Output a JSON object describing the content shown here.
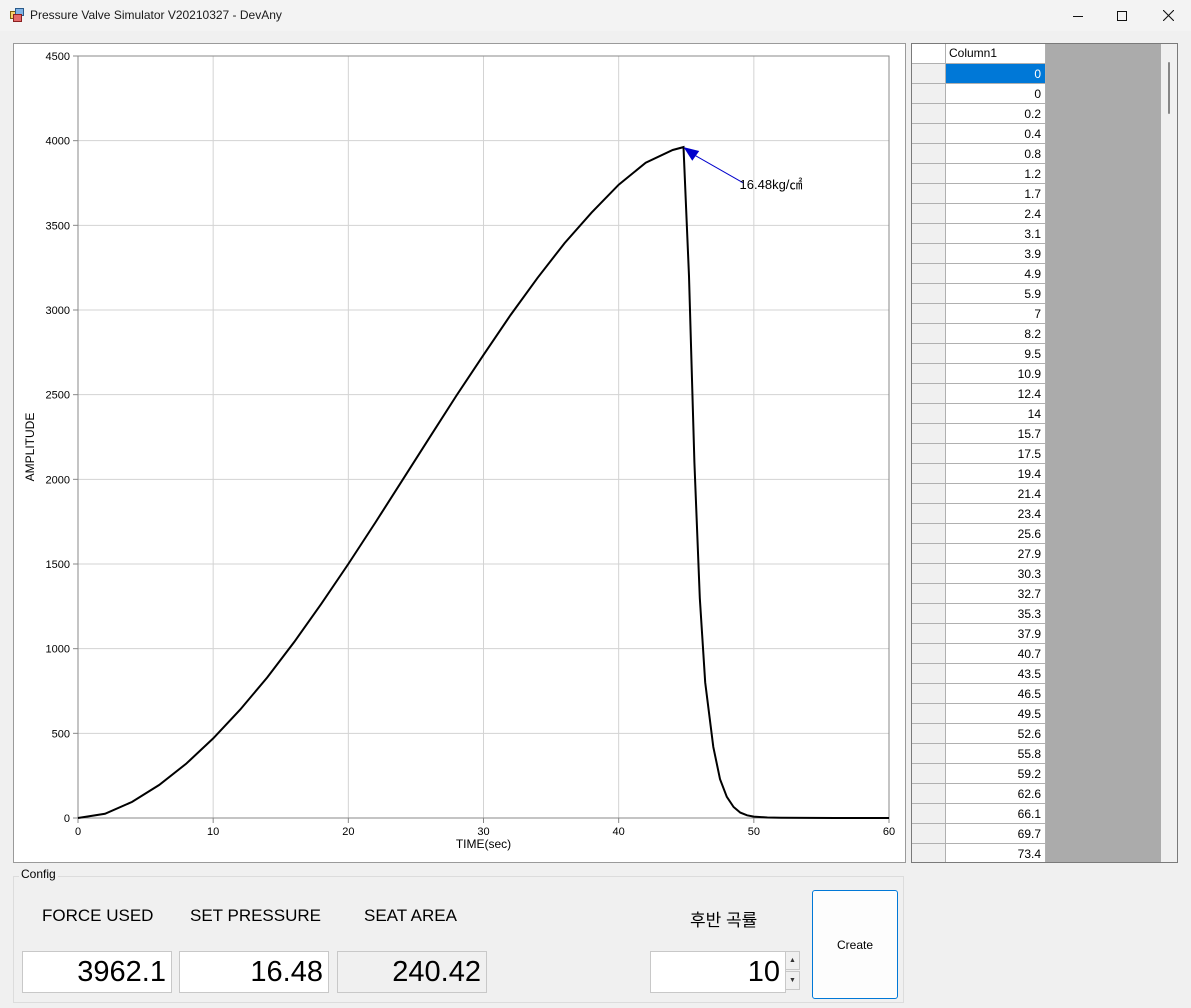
{
  "window": {
    "title": "Pressure Valve Simulator V20210327 - DevAny"
  },
  "chart_data": {
    "type": "line",
    "title": "",
    "xlabel": "TIME(sec)",
    "ylabel": "AMPLITUDE",
    "xlim": [
      0,
      60
    ],
    "ylim": [
      0,
      4500
    ],
    "xticks": [
      "0",
      "10",
      "20",
      "30",
      "40",
      "50",
      "60"
    ],
    "yticks": [
      "0",
      "500",
      "1000",
      "1500",
      "2000",
      "2500",
      "3000",
      "3500",
      "4000",
      "4500"
    ],
    "grid": true,
    "series": [
      {
        "color": "#000000",
        "x": [
          0,
          2,
          4,
          6,
          8,
          10,
          12,
          14,
          16,
          18,
          20,
          22,
          24,
          26,
          28,
          30,
          32,
          34,
          36,
          38,
          40,
          42,
          44,
          44.8,
          45.2,
          45.6,
          46,
          46.4,
          47,
          47.5,
          48,
          48.5,
          49,
          49.5,
          50,
          51,
          52,
          56,
          60
        ],
        "y": [
          0,
          25,
          95,
          195,
          320,
          470,
          640,
          830,
          1040,
          1265,
          1500,
          1745,
          1995,
          2245,
          2495,
          2735,
          2970,
          3190,
          3395,
          3575,
          3740,
          3870,
          3945,
          3962,
          3200,
          2100,
          1300,
          800,
          420,
          230,
          125,
          65,
          32,
          16,
          8,
          3,
          1,
          0,
          0
        ]
      }
    ],
    "annotations": [
      {
        "text": "16.48kg/㎠",
        "x": 44.8,
        "y": 3962,
        "arrow_color": "#0000cc"
      }
    ]
  },
  "grid": {
    "column_header": "Column1",
    "values": [
      "0",
      "0",
      "0.2",
      "0.4",
      "0.8",
      "1.2",
      "1.7",
      "2.4",
      "3.1",
      "3.9",
      "4.9",
      "5.9",
      "7",
      "8.2",
      "9.5",
      "10.9",
      "12.4",
      "14",
      "15.7",
      "17.5",
      "19.4",
      "21.4",
      "23.4",
      "25.6",
      "27.9",
      "30.3",
      "32.7",
      "35.3",
      "37.9",
      "40.7",
      "43.5",
      "46.5",
      "49.5",
      "52.6",
      "55.8",
      "59.2",
      "62.6",
      "66.1",
      "69.7",
      "73.4"
    ],
    "selected_index": 0
  },
  "config": {
    "group_label": "Config",
    "force_used_label": "FORCE USED",
    "set_pressure_label": "SET PRESSURE",
    "seat_area_label": "SEAT AREA",
    "curve_label": "후반 곡률",
    "force_used_value": "3962.1",
    "set_pressure_value": "16.48",
    "seat_area_value": "240.42",
    "curve_value": "10",
    "create_label": "Create"
  }
}
